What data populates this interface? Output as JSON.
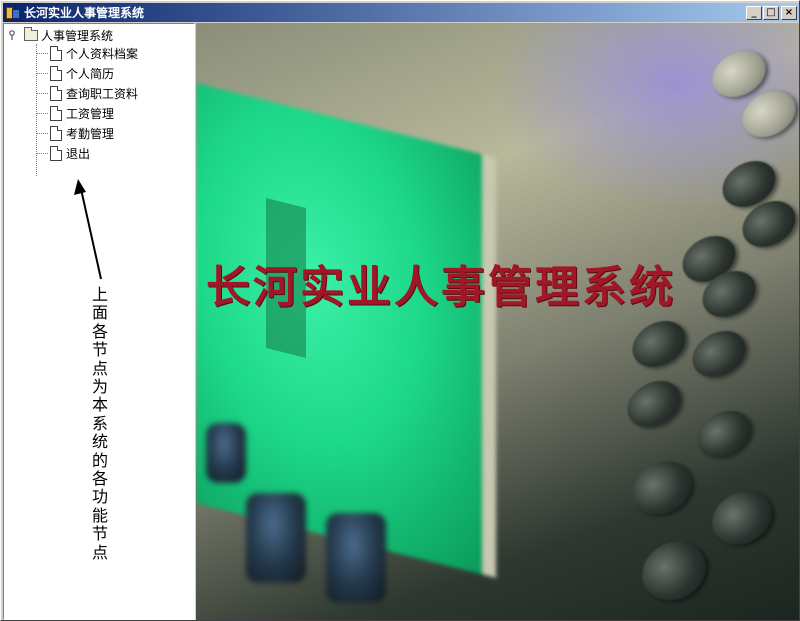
{
  "window": {
    "title": "长河实业人事管理系统",
    "buttons": {
      "minimize": "_",
      "maximize": "□",
      "close": "×"
    }
  },
  "tree": {
    "root_label": "人事管理系统",
    "items": [
      {
        "label": "个人资料档案"
      },
      {
        "label": "个人简历"
      },
      {
        "label": "查询职工资料"
      },
      {
        "label": "工资管理"
      },
      {
        "label": "考勤管理"
      },
      {
        "label": "退出"
      }
    ]
  },
  "annotation": {
    "text": "上面各节点为本系统的各功能节点"
  },
  "banner": {
    "text": "长河实业人事管理系统"
  },
  "colors": {
    "titlebar_start": "#0a246a",
    "titlebar_end": "#a6caf0",
    "banner_text": "#a01828",
    "screen_green": "#1ed98a"
  }
}
